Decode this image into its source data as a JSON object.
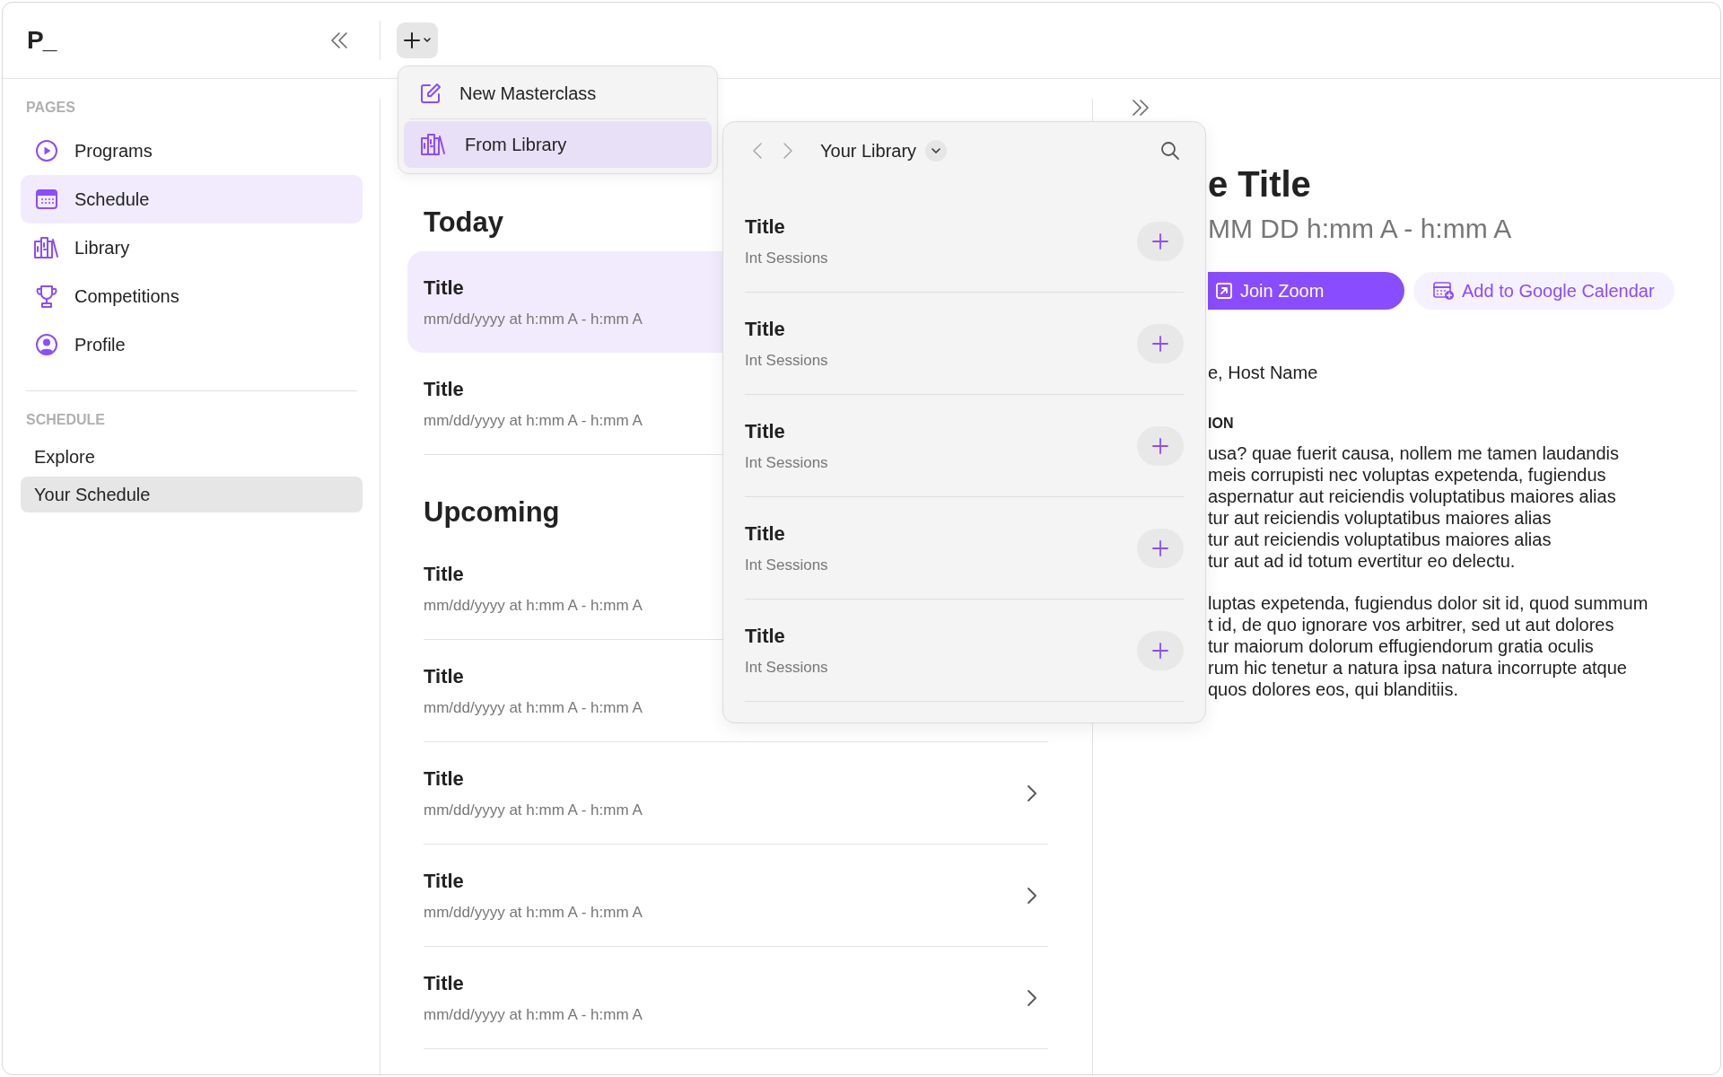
{
  "app": {
    "logo": "P_"
  },
  "sidebar": {
    "sections": [
      {
        "heading": "PAGES",
        "items": [
          {
            "label": "Programs",
            "selected": false
          },
          {
            "label": "Schedule",
            "selected": true
          },
          {
            "label": "Library",
            "selected": false
          },
          {
            "label": "Competitions",
            "selected": false
          },
          {
            "label": "Profile",
            "selected": false
          }
        ]
      },
      {
        "heading": "SCHEDULE",
        "items": [
          {
            "label": "Explore",
            "selected": false
          },
          {
            "label": "Your Schedule",
            "selected": true
          }
        ]
      }
    ]
  },
  "add_menu": {
    "items": [
      {
        "label": "New Masterclass",
        "selected": false
      },
      {
        "label": "From Library",
        "selected": true
      }
    ]
  },
  "schedule": {
    "sections": [
      {
        "heading": "Today",
        "items": [
          {
            "title": "Title",
            "time": "mm/dd/yyyy at h:mm A - h:mm A",
            "selected": true
          },
          {
            "title": "Title",
            "time": "mm/dd/yyyy at h:mm A - h:mm A",
            "selected": false
          }
        ]
      },
      {
        "heading": "Upcoming",
        "items": [
          {
            "title": "Title",
            "time": "mm/dd/yyyy at h:mm A - h:mm A",
            "selected": false
          },
          {
            "title": "Title",
            "time": "mm/dd/yyyy at h:mm A - h:mm A",
            "selected": false
          },
          {
            "title": "Title",
            "time": "mm/dd/yyyy at h:mm A - h:mm A",
            "selected": false
          },
          {
            "title": "Title",
            "time": "mm/dd/yyyy at h:mm A - h:mm A",
            "selected": false
          },
          {
            "title": "Title",
            "time": "mm/dd/yyyy at h:mm A - h:mm A",
            "selected": false
          }
        ]
      }
    ]
  },
  "library": {
    "title": "Your Library",
    "items": [
      {
        "title": "Title",
        "subtitle": "Int Sessions"
      },
      {
        "title": "Title",
        "subtitle": "Int Sessions"
      },
      {
        "title": "Title",
        "subtitle": "Int Sessions"
      },
      {
        "title": "Title",
        "subtitle": "Int Sessions"
      },
      {
        "title": "Title",
        "subtitle": "Int Sessions"
      }
    ]
  },
  "detail": {
    "title": "e Title",
    "datetime": "MM DD h:mm A - h:mm A",
    "buttons": [
      {
        "label": "Join Zoom",
        "kind": "primary"
      },
      {
        "label": "Add to Google Calendar",
        "kind": "secondary"
      }
    ],
    "hosts": "e, Host Name",
    "section_heading": "ION",
    "paragraphs": [
      "usa? quae fuerit causa, nollem me tamen laudandis\nmeis corrupisti nec voluptas expetenda, fugiendus\naspernatur aut reiciendis voluptatibus maiores alias\ntur aut reiciendis voluptatibus maiores alias\ntur aut reiciendis voluptatibus maiores alias\ntur aut ad id totum evertitur eo delectu.",
      "luptas expetenda, fugiendus dolor sit id, quod summum\nt id, de quo ignorare vos arbitrer, sed ut aut dolores\ntur maiorum dolorum effugiendorum gratia  oculis\nrum hic tenetur a natura ipsa natura incorrupte atque\nquos dolores eos, qui blanditiis."
    ]
  }
}
